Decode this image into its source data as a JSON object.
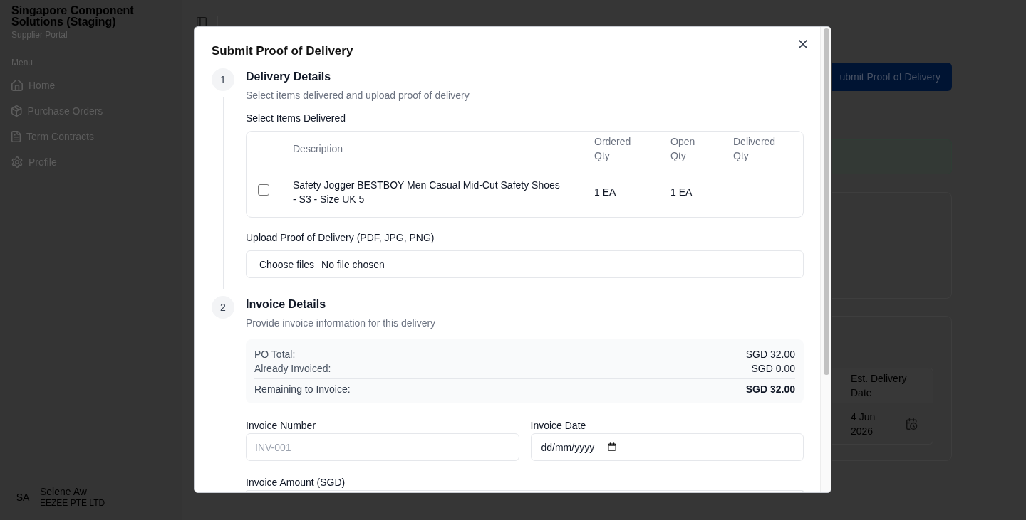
{
  "sidebar": {
    "title": "Singapore Component Solutions (Staging)",
    "subtitle": "Supplier Portal",
    "menu_label": "Menu",
    "items": [
      {
        "label": "Home",
        "selected": false
      },
      {
        "label": "Purchase Orders",
        "selected": false
      },
      {
        "label": "Term Contracts",
        "selected": false
      },
      {
        "label": "Profile",
        "selected": false
      }
    ],
    "user": {
      "initials": "SA",
      "name": "Selene Aw",
      "company": "EEZEE PTE LTD"
    }
  },
  "page": {
    "action_button": "ubmit Proof of Delivery",
    "table": {
      "columns": [
        "Est. Delivery Date"
      ],
      "rows": [
        [
          "4 Jun 2026"
        ]
      ]
    }
  },
  "dialog": {
    "title": "Submit Proof of Delivery",
    "steps": [
      {
        "number": "1",
        "title": "Delivery Details",
        "subtitle": "Select items delivered and upload proof of delivery",
        "items": {
          "label": "Select Items Delivered",
          "columns": [
            "Description",
            "Ordered Qty",
            "Open Qty",
            "Delivered Qty"
          ],
          "rows": [
            {
              "checked": false,
              "description": "Safety Jogger BESTBOY Men Casual Mid-Cut Safety Shoes - S3 - Size UK 5",
              "ordered_qty": "1 EA",
              "open_qty": "1 EA"
            }
          ]
        },
        "upload": {
          "label": "Upload Proof of Delivery (PDF, JPG, PNG)",
          "button": "Choose files",
          "status": "No file chosen"
        }
      },
      {
        "number": "2",
        "title": "Invoice Details",
        "subtitle": "Provide invoice information for this delivery",
        "summary": [
          {
            "kind": "line",
            "label": "PO Total:",
            "value": "SGD 32.00"
          },
          {
            "kind": "line",
            "label": "Already Invoiced:",
            "value": "SGD 0.00"
          },
          {
            "kind": "total",
            "label": "Remaining to Invoice:",
            "value": "SGD 32.00"
          }
        ],
        "fields": [
          {
            "kind": "text",
            "label": "Invoice Number",
            "placeholder": "INV-001"
          },
          {
            "kind": "date",
            "label": "Invoice Date",
            "placeholder": "dd/mm/yyyy"
          },
          {
            "kind": "text",
            "label": "Invoice Amount (SGD)"
          }
        ]
      }
    ]
  }
}
